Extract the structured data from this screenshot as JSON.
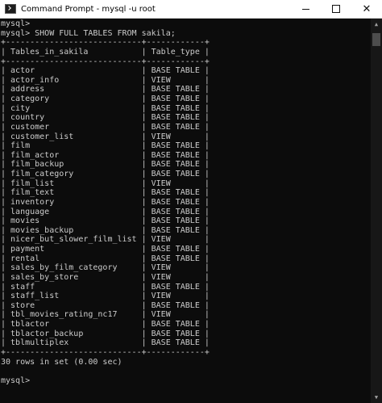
{
  "window": {
    "title": "Command Prompt - mysql  -u root",
    "icons": {
      "app": "cmd-icon",
      "minimize": "minimize-icon",
      "maximize": "maximize-icon",
      "close": "close-icon"
    },
    "close_glyph": "✕"
  },
  "terminal": {
    "lines": [
      "mysql>",
      "mysql> SHOW FULL TABLES FROM sakila;",
      "+----------------------------+------------+",
      "| Tables_in_sakila           | Table_type |",
      "+----------------------------+------------+",
      "| actor                      | BASE TABLE |",
      "| actor_info                 | VIEW       |",
      "| address                    | BASE TABLE |",
      "| category                   | BASE TABLE |",
      "| city                       | BASE TABLE |",
      "| country                    | BASE TABLE |",
      "| customer                   | BASE TABLE |",
      "| customer_list              | VIEW       |",
      "| film                       | BASE TABLE |",
      "| film_actor                 | BASE TABLE |",
      "| film_backup                | BASE TABLE |",
      "| film_category              | BASE TABLE |",
      "| film_list                  | VIEW       |",
      "| film_text                  | BASE TABLE |",
      "| inventory                  | BASE TABLE |",
      "| language                   | BASE TABLE |",
      "| movies                     | BASE TABLE |",
      "| movies_backup              | BASE TABLE |",
      "| nicer_but_slower_film_list | VIEW       |",
      "| payment                    | BASE TABLE |",
      "| rental                     | BASE TABLE |",
      "| sales_by_film_category     | VIEW       |",
      "| sales_by_store             | VIEW       |",
      "| staff                      | BASE TABLE |",
      "| staff_list                 | VIEW       |",
      "| store                      | BASE TABLE |",
      "| tbl_movies_rating_nc17     | VIEW       |",
      "| tblactor                   | BASE TABLE |",
      "| tblactor_backup            | BASE TABLE |",
      "| tblmultiplex               | BASE TABLE |",
      "+----------------------------+------------+",
      "30 rows in set (0.00 sec)",
      "",
      "mysql>"
    ]
  },
  "scrollbar": {
    "up_glyph": "▲",
    "down_glyph": "▼"
  },
  "colors": {
    "console_bg": "#0c0c0c",
    "console_text": "#cccccc",
    "titlebar_bg": "#ffffff"
  }
}
